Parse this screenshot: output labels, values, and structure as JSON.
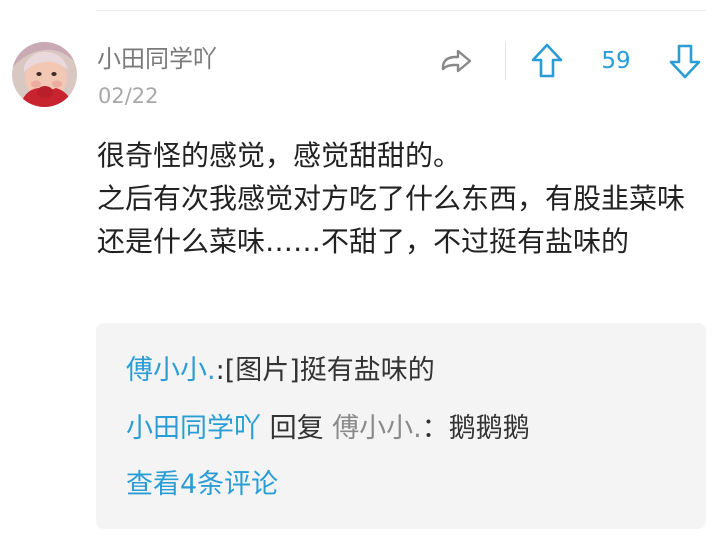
{
  "comment": {
    "username": "小田同学吖",
    "date": "02/22",
    "vote_count": "59",
    "text": "很奇怪的感觉，感觉甜甜的。\n之后有次我感觉对方吃了什么东西，有股韭菜味还是什么菜味……不甜了，不过挺有盐味的"
  },
  "replies": [
    {
      "author": "傅小小.",
      "separator": ":",
      "content": "[图片]挺有盐味的"
    },
    {
      "author": "小田同学吖",
      "reply_word": "回复",
      "target": "傅小小.",
      "separator": "：",
      "content": "鹅鹅鹅"
    }
  ],
  "view_more_label": "查看4条评论",
  "icons": {
    "share": "share-icon",
    "upvote": "upvote-arrow-icon",
    "downvote": "downvote-arrow-icon"
  },
  "colors": {
    "accent": "#2a9ed4",
    "username": "#7a7a7a",
    "date": "#a8a8a8",
    "body_text": "#222222",
    "reply_box_bg": "#f4f4f5"
  }
}
